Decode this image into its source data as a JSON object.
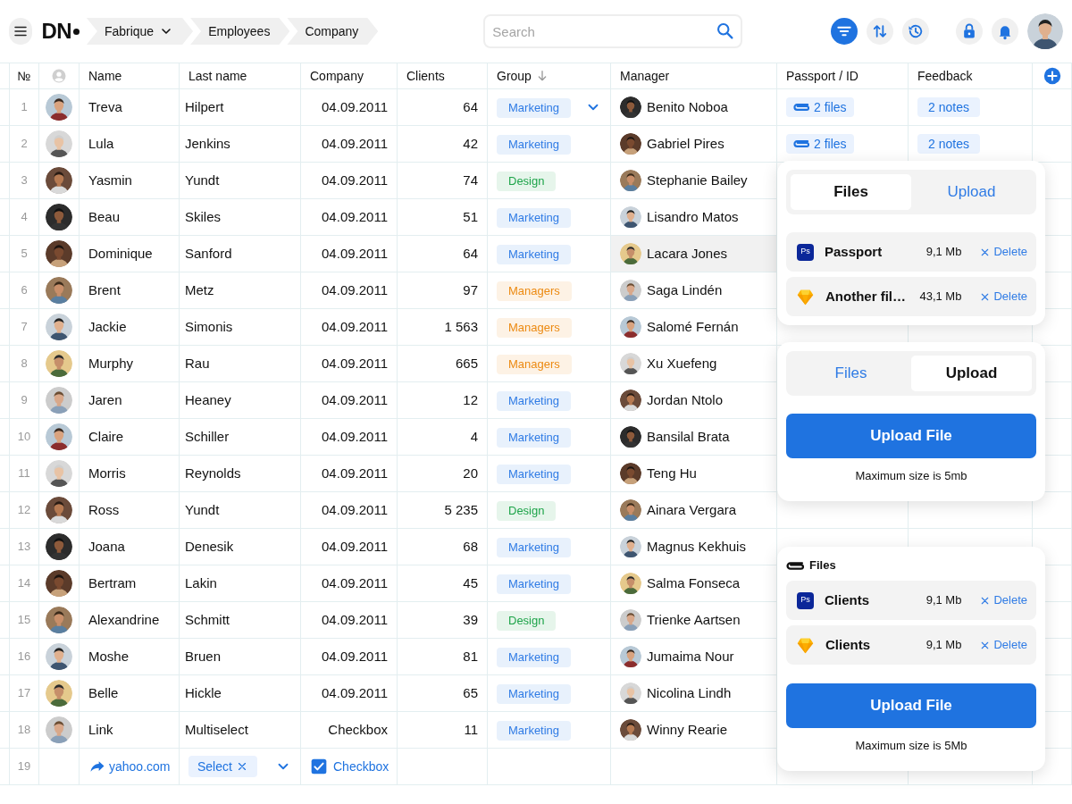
{
  "topbar": {
    "logo": "DN",
    "breadcrumbs": [
      {
        "label": "Fabrique",
        "dropdown": true
      },
      {
        "label": "Employees",
        "dropdown": false
      },
      {
        "label": "Company",
        "dropdown": false
      }
    ],
    "search": {
      "placeholder": "Search"
    },
    "tools": [
      {
        "kind": "filter",
        "active": true
      },
      {
        "kind": "sort",
        "active": false
      },
      {
        "kind": "history",
        "active": false
      },
      {
        "kind": "lock",
        "active": false
      },
      {
        "kind": "bell",
        "active": false
      }
    ]
  },
  "table": {
    "columns": [
      {
        "kind": "number",
        "label": "№"
      },
      {
        "kind": "avatar"
      },
      {
        "kind": "text",
        "label": "Name"
      },
      {
        "kind": "text",
        "label": "Last name"
      },
      {
        "kind": "text",
        "label": "Company"
      },
      {
        "kind": "text",
        "label": "Clients"
      },
      {
        "kind": "text",
        "label": "Group",
        "sorted": true
      },
      {
        "kind": "text",
        "label": "Manager"
      },
      {
        "kind": "text",
        "label": "Passport / ID"
      },
      {
        "kind": "text",
        "label": "Feedback"
      },
      {
        "kind": "add"
      }
    ],
    "rows": [
      {
        "kind": "person",
        "number": "1",
        "name": "Treva",
        "last_name": "Hilpert",
        "company": "04.09.2011",
        "clients": "64",
        "group": {
          "label": "Marketing",
          "color": "#2f7be5",
          "dropdown": true
        },
        "manager": "Benito Noboa",
        "highlighted": false,
        "passport": "2 files",
        "feedback": "2 notes"
      },
      {
        "kind": "person",
        "number": "2",
        "name": "Lula",
        "last_name": "Jenkins",
        "company": "04.09.2011",
        "clients": "42",
        "group": {
          "label": "Marketing",
          "color": "#2f7be5",
          "dropdown": false
        },
        "manager": "Gabriel Pires",
        "highlighted": false,
        "passport": "2 files",
        "feedback": "2 notes"
      },
      {
        "kind": "person",
        "number": "3",
        "name": "Yasmin",
        "last_name": "Yundt",
        "company": "04.09.2011",
        "clients": "74",
        "group": {
          "label": "Design",
          "color": "#1ea44a",
          "dropdown": false
        },
        "manager": "Stephanie Bailey",
        "highlighted": false
      },
      {
        "kind": "person",
        "number": "4",
        "name": "Beau",
        "last_name": "Skiles",
        "company": "04.09.2011",
        "clients": "51",
        "group": {
          "label": "Marketing",
          "color": "#2f7be5",
          "dropdown": false
        },
        "manager": "Lisandro Matos",
        "highlighted": false
      },
      {
        "kind": "person",
        "number": "5",
        "name": "Dominique",
        "last_name": "Sanford",
        "company": "04.09.2011",
        "clients": "64",
        "group": {
          "label": "Marketing",
          "color": "#2f7be5",
          "dropdown": false
        },
        "manager": "Lacara Jones",
        "highlighted": true
      },
      {
        "kind": "person",
        "number": "6",
        "name": "Brent",
        "last_name": "Metz",
        "company": "04.09.2011",
        "clients": "97",
        "group": {
          "label": "Managers",
          "color": "#ec8a12",
          "dropdown": false
        },
        "manager": "Saga Lindén",
        "highlighted": false
      },
      {
        "kind": "person",
        "number": "7",
        "name": "Jackie",
        "last_name": "Simonis",
        "company": "04.09.2011",
        "clients": "1 563",
        "group": {
          "label": "Managers",
          "color": "#ec8a12",
          "dropdown": false
        },
        "manager": "Salomé Fernán",
        "highlighted": false
      },
      {
        "kind": "person",
        "number": "8",
        "name": "Murphy",
        "last_name": "Rau",
        "company": "04.09.2011",
        "clients": "665",
        "group": {
          "label": "Managers",
          "color": "#ec8a12",
          "dropdown": false
        },
        "manager": "Xu Xuefeng",
        "highlighted": false
      },
      {
        "kind": "person",
        "number": "9",
        "name": "Jaren",
        "last_name": "Heaney",
        "company": "04.09.2011",
        "clients": "12",
        "group": {
          "label": "Marketing",
          "color": "#2f7be5",
          "dropdown": false
        },
        "manager": "Jordan Ntolo",
        "highlighted": false
      },
      {
        "kind": "person",
        "number": "10",
        "name": "Claire",
        "last_name": "Schiller",
        "company": "04.09.2011",
        "clients": "4",
        "group": {
          "label": "Marketing",
          "color": "#2f7be5",
          "dropdown": false
        },
        "manager": "Bansilal Brata",
        "highlighted": false
      },
      {
        "kind": "person",
        "number": "11",
        "name": "Morris",
        "last_name": "Reynolds",
        "company": "04.09.2011",
        "clients": "20",
        "group": {
          "label": "Marketing",
          "color": "#2f7be5",
          "dropdown": false
        },
        "manager": "Teng Hu",
        "highlighted": false
      },
      {
        "kind": "person",
        "number": "12",
        "name": "Ross",
        "last_name": "Yundt",
        "company": "04.09.2011",
        "clients": "5 235",
        "group": {
          "label": "Design",
          "color": "#1ea44a",
          "dropdown": false
        },
        "manager": "Ainara Vergara",
        "highlighted": false
      },
      {
        "kind": "person",
        "number": "13",
        "name": "Joana",
        "last_name": "Denesik",
        "company": "04.09.2011",
        "clients": "68",
        "group": {
          "label": "Marketing",
          "color": "#2f7be5",
          "dropdown": false
        },
        "manager": "Magnus Kekhuis",
        "highlighted": false
      },
      {
        "kind": "person",
        "number": "14",
        "name": "Bertram",
        "last_name": "Lakin",
        "company": "04.09.2011",
        "clients": "45",
        "group": {
          "label": "Marketing",
          "color": "#2f7be5",
          "dropdown": false
        },
        "manager": "Salma Fonseca",
        "highlighted": false
      },
      {
        "kind": "person",
        "number": "15",
        "name": "Alexandrine",
        "last_name": "Schmitt",
        "company": "04.09.2011",
        "clients": "39",
        "group": {
          "label": "Design",
          "color": "#1ea44a",
          "dropdown": false
        },
        "manager": "Trienke Aartsen",
        "highlighted": false
      },
      {
        "kind": "person",
        "number": "16",
        "name": "Moshe",
        "last_name": "Bruen",
        "company": "04.09.2011",
        "clients": "81",
        "group": {
          "label": "Marketing",
          "color": "#2f7be5",
          "dropdown": false
        },
        "manager": "Jumaima Nour",
        "highlighted": false
      },
      {
        "kind": "person",
        "number": "17",
        "name": "Belle",
        "last_name": "Hickle",
        "company": "04.09.2011",
        "clients": "65",
        "group": {
          "label": "Marketing",
          "color": "#2f7be5",
          "dropdown": false
        },
        "manager": "Nicolina Lindh",
        "highlighted": false
      },
      {
        "kind": "person",
        "number": "18",
        "name": "Link",
        "last_name": "Multiselect",
        "company": "Checkbox",
        "clients": "11",
        "group": {
          "label": "Marketing",
          "color": "#2f7be5",
          "dropdown": false
        },
        "manager": "Winny Rearie",
        "highlighted": false
      },
      {
        "kind": "controls",
        "number": "19",
        "link": "yahoo.com",
        "select": "Select",
        "checkbox": {
          "label": "Checkbox",
          "checked": true
        }
      }
    ]
  },
  "popovers": [
    {
      "tabs": [
        {
          "label": "Files",
          "selected": true
        },
        {
          "label": "Upload",
          "selected": false
        }
      ],
      "files": [
        {
          "kind": "ps",
          "badge": "Ps",
          "name": "Passport",
          "size": "9,1 Mb",
          "action": "Delete"
        },
        {
          "kind": "sketch",
          "name": "Another fil…",
          "size": "43,1 Mb",
          "action": "Delete"
        }
      ]
    },
    {
      "tabs": [
        {
          "label": "Files",
          "selected": false
        },
        {
          "label": "Upload",
          "selected": true
        }
      ],
      "upload": {
        "button": "Upload File",
        "note": "Maximum size is 5mb"
      }
    },
    {
      "heading": "Files",
      "files": [
        {
          "kind": "ps",
          "badge": "Ps",
          "name": "Clients",
          "size": "9,1 Mb",
          "action": "Delete"
        },
        {
          "kind": "sketch",
          "name": "Clients",
          "size": "9,1 Mb",
          "action": "Delete"
        }
      ],
      "upload": {
        "button": "Upload File",
        "note": "Maximum size is 5Mb"
      }
    }
  ]
}
